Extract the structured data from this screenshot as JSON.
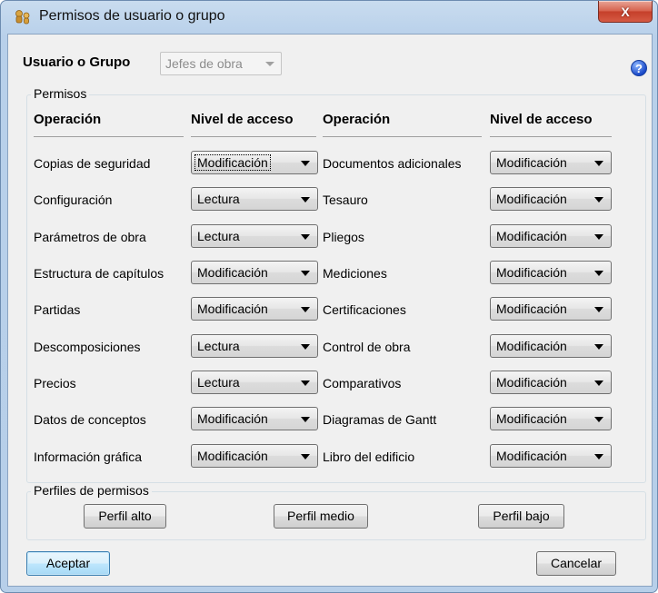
{
  "window": {
    "title": "Permisos de usuario o grupo",
    "close_label": "X"
  },
  "user": {
    "label": "Usuario o Grupo",
    "value": "Jefes de obra"
  },
  "help_label": "?",
  "permisos": {
    "label": "Permisos",
    "headers": {
      "operation": "Operación",
      "level": "Nivel de acceso"
    },
    "left": [
      {
        "op": "Copias de seguridad",
        "level": "Modificación"
      },
      {
        "op": "Configuración",
        "level": "Lectura"
      },
      {
        "op": "Parámetros de obra",
        "level": "Lectura"
      },
      {
        "op": "Estructura de capítulos",
        "level": "Modificación"
      },
      {
        "op": "Partidas",
        "level": "Modificación"
      },
      {
        "op": "Descomposiciones",
        "level": "Lectura"
      },
      {
        "op": "Precios",
        "level": "Lectura"
      },
      {
        "op": "Datos de conceptos",
        "level": "Modificación"
      },
      {
        "op": "Información gráfica",
        "level": "Modificación"
      }
    ],
    "right": [
      {
        "op": "Documentos adicionales",
        "level": "Modificación"
      },
      {
        "op": "Tesauro",
        "level": "Modificación"
      },
      {
        "op": "Pliegos",
        "level": "Modificación"
      },
      {
        "op": "Mediciones",
        "level": "Modificación"
      },
      {
        "op": "Certificaciones",
        "level": "Modificación"
      },
      {
        "op": "Control de obra",
        "level": "Modificación"
      },
      {
        "op": "Comparativos",
        "level": "Modificación"
      },
      {
        "op": "Diagramas de Gantt",
        "level": "Modificación"
      },
      {
        "op": "Libro del edificio",
        "level": "Modificación"
      }
    ]
  },
  "perfiles": {
    "label": "Perfiles de permisos",
    "alto": "Perfil alto",
    "medio": "Perfil medio",
    "bajo": "Perfil bajo"
  },
  "footer": {
    "accept": "Aceptar",
    "cancel": "Cancelar"
  }
}
